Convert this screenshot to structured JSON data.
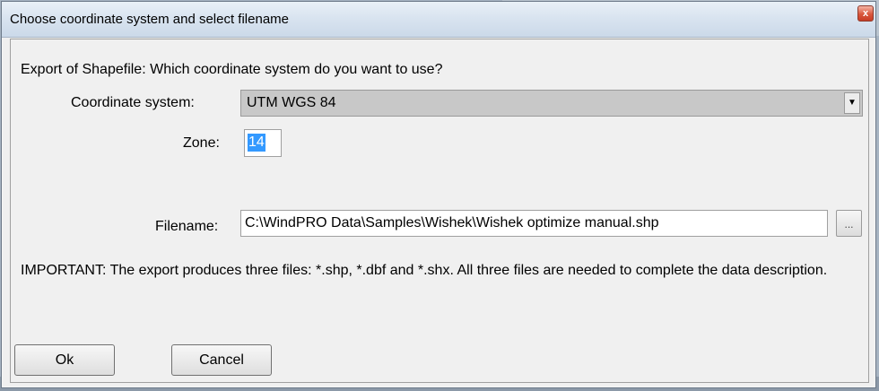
{
  "window": {
    "title": "Choose coordinate system and select filename",
    "close_glyph": "x"
  },
  "form": {
    "question": "Export of Shapefile: Which coordinate system do you want to use?",
    "coordinate_system_label": "Coordinate system:",
    "coordinate_system_value": "UTM WGS 84",
    "zone_label": "Zone:",
    "zone_value": "14",
    "filename_label": "Filename:",
    "filename_value": "C:\\WindPRO Data\\Samples\\Wishek\\Wishek optimize manual.shp",
    "browse_label": "...",
    "important_note": "IMPORTANT: The export produces three files: *.shp, *.dbf and *.shx. All three files are needed to complete the data description."
  },
  "buttons": {
    "ok_label": "Ok",
    "cancel_label": "Cancel"
  },
  "icons": {
    "combo_dropdown": "chevron-down-icon",
    "close": "close-icon"
  },
  "colors": {
    "dialog_background": "#f0f0f0",
    "selection": "#3399ff",
    "close_button": "#d9573d"
  }
}
